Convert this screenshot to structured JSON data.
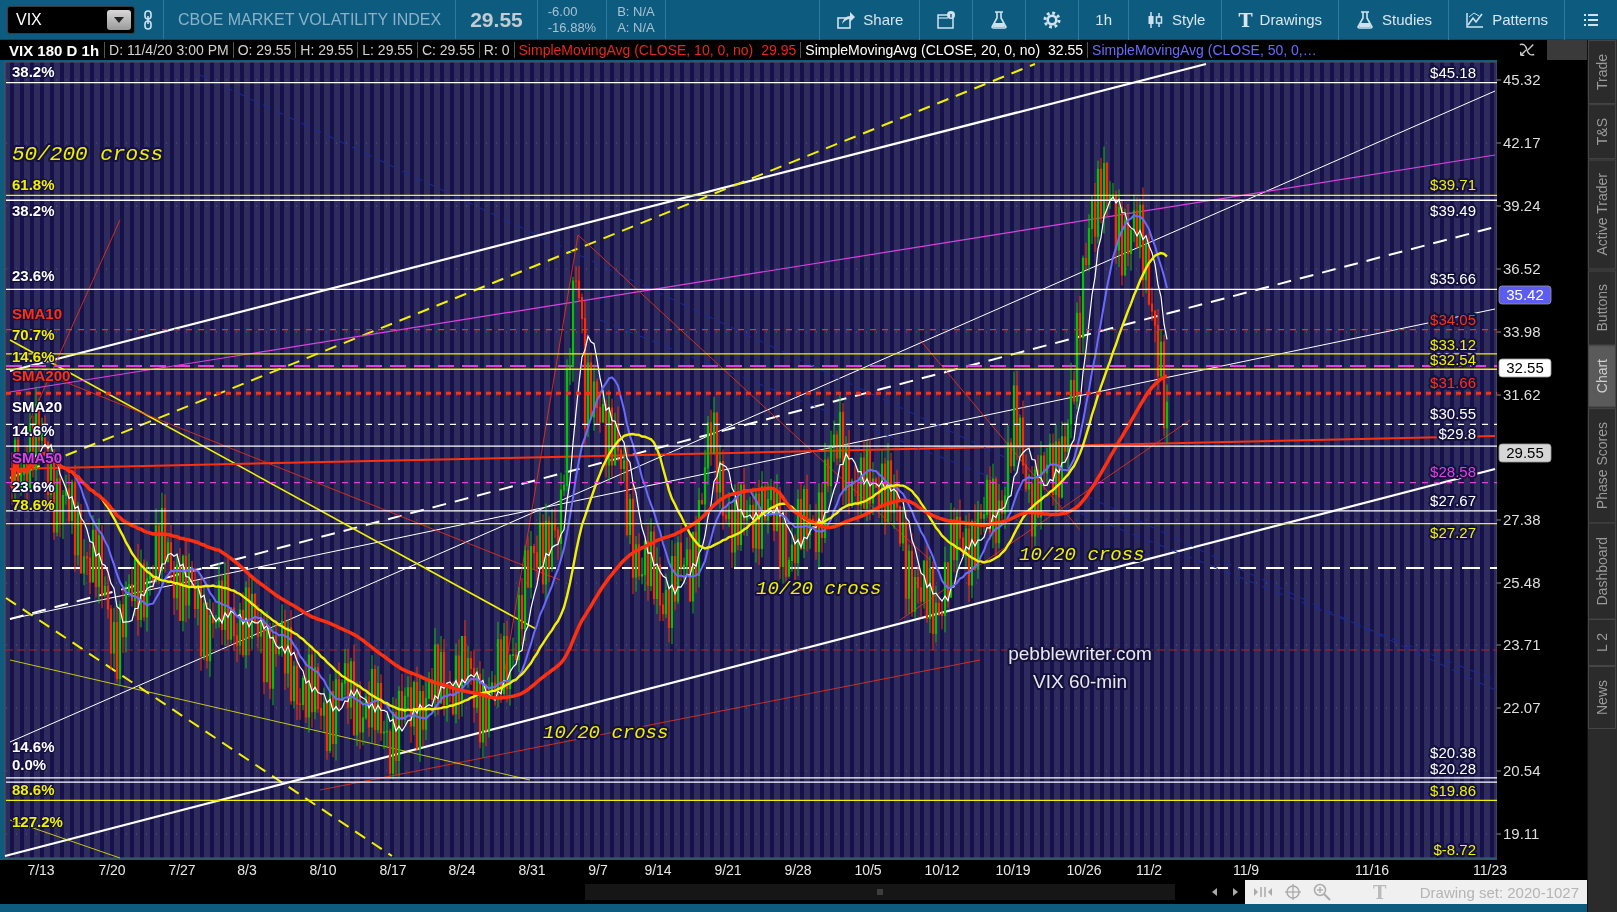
{
  "toolbar": {
    "symbol": "VIX",
    "description": "CBOE MARKET VOLATILITY INDEX",
    "last": "29.55",
    "change": "-6.00",
    "change_pct": "-16.88%",
    "bid": "B: N/A",
    "ask": "A: N/A",
    "buttons": [
      {
        "kind": "share",
        "label": "Share"
      },
      {
        "kind": "info"
      },
      {
        "kind": "flask"
      },
      {
        "kind": "gear"
      },
      {
        "kind": "text",
        "label": "1h"
      },
      {
        "kind": "style",
        "label": "Style"
      },
      {
        "kind": "drawings",
        "glyph": "T",
        "label": "Drawings"
      },
      {
        "kind": "studies",
        "label": "Studies"
      },
      {
        "kind": "patterns",
        "label": "Patterns"
      },
      {
        "kind": "menu"
      }
    ]
  },
  "info_bar": {
    "title": "VIX 180 D 1h",
    "fields": [
      "D: 11/4/20 3:00 PM",
      "O: 29.55",
      "H: 29.55",
      "L: 29.55",
      "C: 29.55",
      "R: 0"
    ],
    "studies": [
      {
        "label": "SimpleMovingAvg (CLOSE, 10, 0, no)",
        "value": "29.95",
        "color": "#e8261e"
      },
      {
        "label": "SimpleMovingAvg (CLOSE, 20, 0, no)",
        "value": "32.55",
        "color": "#ffffff"
      },
      {
        "label": "SimpleMovingAvg (CLOSE, 50, 0,…",
        "color": "#6a6aff"
      }
    ]
  },
  "chart": {
    "price_ticks": [
      "45.32",
      "42.17",
      "39.24",
      "36.52",
      "33.98",
      "31.62",
      "27.38",
      "25.48",
      "23.71",
      "22.07",
      "20.54",
      "19.11"
    ],
    "price_markers": [
      {
        "text": "35.42",
        "color": "#5c5cf0"
      },
      {
        "text": "32.55",
        "color": "#ffffff"
      },
      {
        "text": "29.55",
        "color": "#d6d6d6"
      }
    ],
    "levels": [
      {
        "label": "$45.18",
        "color": "#ffffff",
        "kind": "solid"
      },
      {
        "label": "$39.71",
        "color": "#f0f000",
        "kind": "solid"
      },
      {
        "label": "$39.49",
        "color": "#ffffff",
        "kind": "solid"
      },
      {
        "label": "$35.66",
        "color": "#ffffff",
        "kind": "solid"
      },
      {
        "label": "$34.05",
        "color": "#ff3010",
        "kind": "dashed"
      },
      {
        "label": "$33.12",
        "color": "#f0f000",
        "kind": "solid"
      },
      {
        "label": "$32.54",
        "color": "#f0f000",
        "kind": "solid"
      },
      {
        "label": "$31.66",
        "color": "#ff3010",
        "kind": "dotted"
      },
      {
        "label": "$30.55",
        "color": "#ffffff",
        "kind": "dashed"
      },
      {
        "label": "$29.8",
        "color": "#ffffff",
        "kind": "solid"
      },
      {
        "label": "$28.58",
        "color": "#e040e0",
        "kind": "dashed"
      },
      {
        "label": "$27.67",
        "color": "#ffffff",
        "kind": "solid"
      },
      {
        "label": "$27.27",
        "color": "#f0f000",
        "kind": "solid"
      },
      {
        "label": "$20.38",
        "color": "#ffffff",
        "kind": "solid"
      },
      {
        "label": "$20.28",
        "color": "#ffffff",
        "kind": "solid"
      },
      {
        "label": "$19.86",
        "color": "#f0f000",
        "kind": "solid"
      },
      {
        "label": "$-8.72",
        "color": "#f0f000",
        "kind": "label"
      }
    ],
    "left_labels": [
      {
        "text": "38.2%",
        "color": "#ffffff"
      },
      {
        "text": "61.8%",
        "color": "#f0f000"
      },
      {
        "text": "38.2%",
        "color": "#ffffff"
      },
      {
        "text": "23.6%",
        "color": "#ffffff"
      },
      {
        "text": "SMA10",
        "color": "#ff3010"
      },
      {
        "text": "70.7%",
        "color": "#f0f000"
      },
      {
        "text": "14.6%",
        "color": "#f0f000"
      },
      {
        "text": "SMA200",
        "color": "#ff3010"
      },
      {
        "text": "SMA20",
        "color": "#ffffff"
      },
      {
        "text": "14.6%",
        "color": "#ffffff"
      },
      {
        "text": "SMA50",
        "color": "#e040e0"
      },
      {
        "text": "23.6%",
        "color": "#ffffff"
      },
      {
        "text": "78.6%",
        "color": "#f0f000"
      },
      {
        "text": "14.6%",
        "color": "#ffffff"
      },
      {
        "text": "0.0%",
        "color": "#ffffff"
      },
      {
        "text": "88.6%",
        "color": "#f0f000"
      },
      {
        "text": "127.2%",
        "color": "#f0f000"
      }
    ],
    "annotations": [
      {
        "text": "50/200 cross",
        "color": "#f0f000"
      },
      {
        "text": "10/20 cross",
        "color": "#f0f000"
      },
      {
        "text": "10/20 cross",
        "color": "#f0f000"
      },
      {
        "text": "10/20 cross",
        "color": "#f0f000"
      },
      {
        "text": "pebblewriter.com",
        "color": "#e8e8e8"
      },
      {
        "text": "VIX 60-min",
        "color": "#e8e8e8"
      }
    ],
    "date_ticks": [
      "7/13",
      "7/20",
      "7/27",
      "8/3",
      "8/10",
      "8/17",
      "8/24",
      "8/31",
      "9/7",
      "9/14",
      "9/21",
      "9/28",
      "10/5",
      "10/12",
      "10/19",
      "10/26",
      "11/2",
      "11/9",
      "11/16",
      "11/23"
    ]
  },
  "side_tabs": [
    {
      "label": "Trade",
      "selected": false
    },
    {
      "label": "T&S",
      "selected": false
    },
    {
      "label": "Active Trader",
      "selected": false
    },
    {
      "label": "Buttons",
      "selected": false
    },
    {
      "label": "Chart",
      "selected": true
    },
    {
      "label": "Phase Scores",
      "selected": false
    },
    {
      "label": "Dashboard",
      "selected": false
    },
    {
      "label": "L 2",
      "selected": false
    },
    {
      "label": "News",
      "selected": false
    }
  ],
  "status_bar": {
    "tool_glyph": "T",
    "drawing_set": "Drawing set: 2020-1027"
  }
}
